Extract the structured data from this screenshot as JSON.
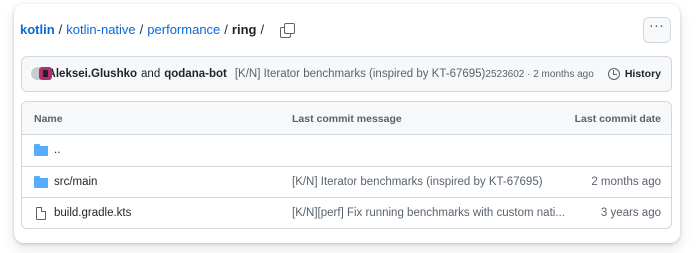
{
  "breadcrumb": {
    "root": "kotlin",
    "parts": [
      "kotlin-native",
      "performance"
    ],
    "current": "ring",
    "separator": "/"
  },
  "more_button": {
    "label": "···"
  },
  "commit": {
    "author1": "Aleksei.Glushko",
    "and": "and",
    "author2": "qodana-bot",
    "message": "[K/N] Iterator benchmarks (inspired by KT-67695)",
    "meta": "2523602 · 2 months ago",
    "history_label": "History"
  },
  "table": {
    "headers": {
      "name": "Name",
      "message": "Last commit message",
      "date": "Last commit date"
    },
    "rows": [
      {
        "icon": "folder-icon",
        "name": "..",
        "message": "",
        "date": ""
      },
      {
        "icon": "folder-icon",
        "name": "src/main",
        "message": "[K/N] Iterator benchmarks (inspired by KT-67695)",
        "date": "2 months ago"
      },
      {
        "icon": "file-icon",
        "name": "build.gradle.kts",
        "message": "[K/N][perf] Fix running benchmarks with custom nati...",
        "date": "3 years ago"
      }
    ]
  },
  "colors": {
    "link": "#0969da",
    "folder": "#54aeff",
    "muted": "#59636e",
    "border": "#d1d9e0",
    "header_bg": "#f6f8fa"
  }
}
